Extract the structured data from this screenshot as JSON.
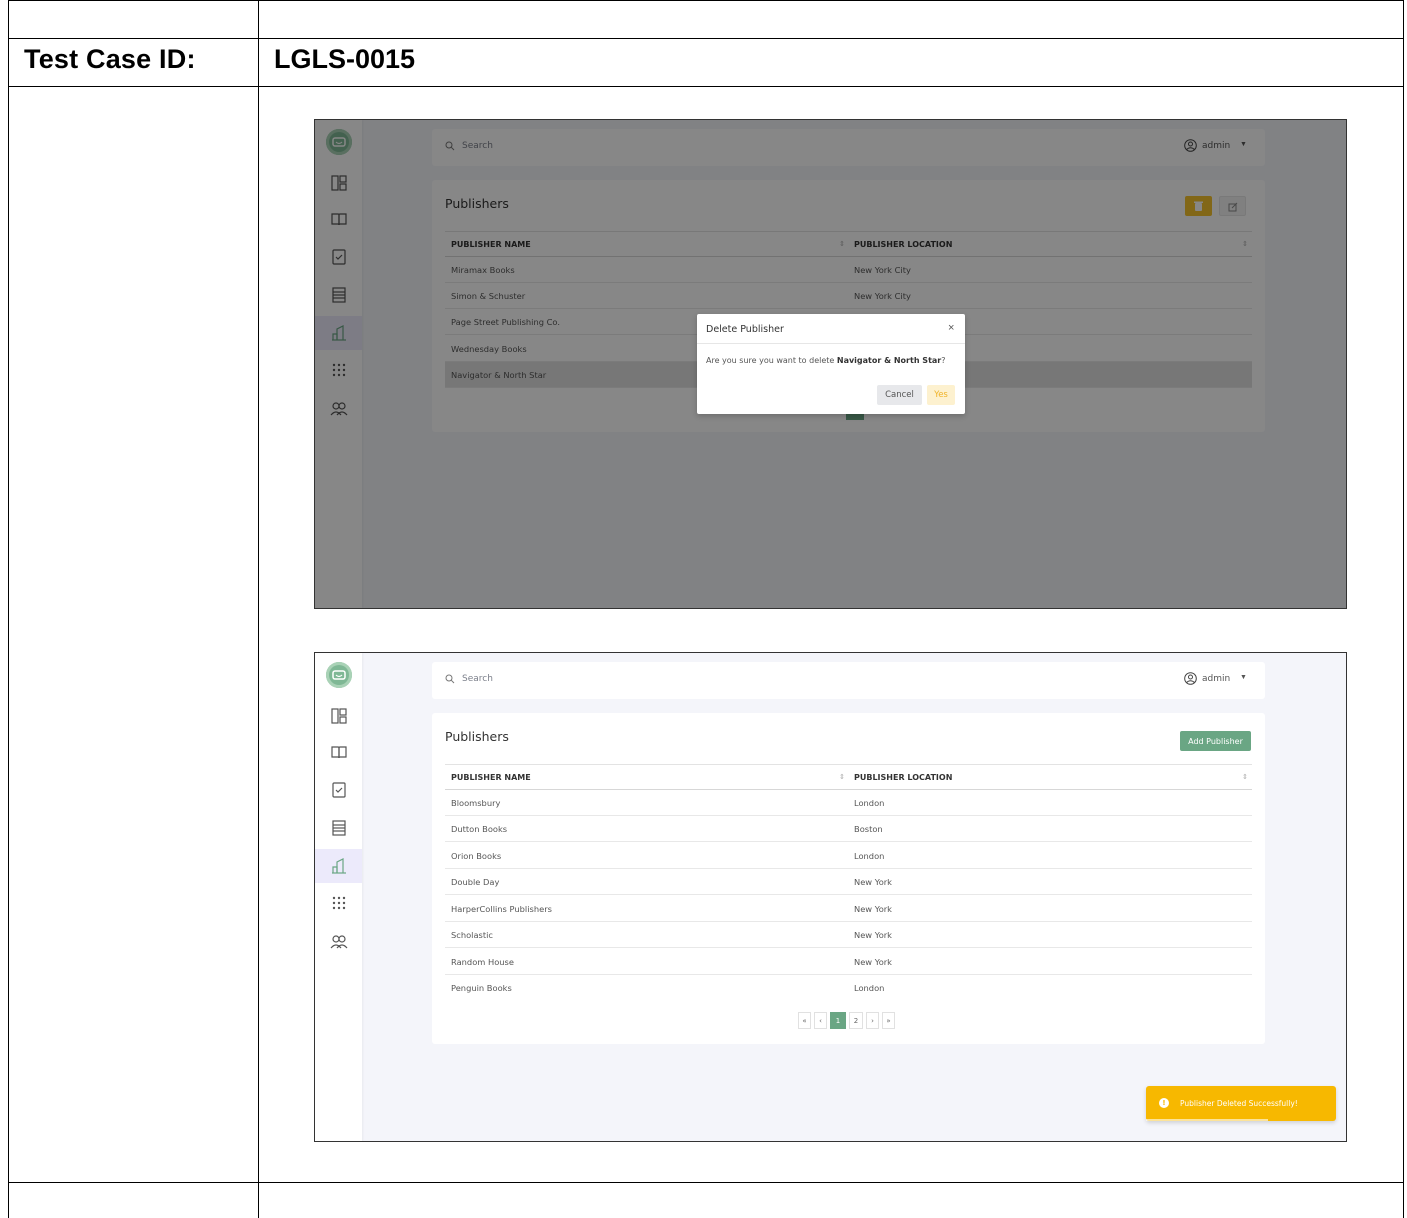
{
  "document": {
    "test_case_label": "Test Case ID:",
    "test_case_value": "LGLS-0015"
  },
  "screen1": {
    "search_placeholder": "Search",
    "user_name": "admin",
    "panel_title": "Publishers",
    "columns": [
      "PUBLISHER NAME",
      "PUBLISHER LOCATION"
    ],
    "rows": [
      {
        "name": "Miramax Books",
        "location": "New York City"
      },
      {
        "name": "Simon & Schuster",
        "location": "New York City"
      },
      {
        "name": "Page Street Publishing Co.",
        "location": ""
      },
      {
        "name": "Wednesday Books",
        "location": ""
      },
      {
        "name": "Navigator & North Star",
        "location": ""
      }
    ],
    "modal": {
      "title": "Delete Publisher",
      "close": "×",
      "message_prefix": "Are you sure you want to delete ",
      "message_bold": "Navigator & North Star",
      "message_suffix": "?",
      "cancel_label": "Cancel",
      "yes_label": "Yes"
    }
  },
  "screen2": {
    "search_placeholder": "Search",
    "user_name": "admin",
    "panel_title": "Publishers",
    "add_button_label": "Add Publisher",
    "columns": [
      "PUBLISHER NAME",
      "PUBLISHER LOCATION"
    ],
    "rows": [
      {
        "name": "Bloomsbury",
        "location": "London"
      },
      {
        "name": "Dutton Books",
        "location": "Boston"
      },
      {
        "name": "Orion Books",
        "location": "London"
      },
      {
        "name": "Double Day",
        "location": "New York"
      },
      {
        "name": "HarperCollins Publishers",
        "location": "New York"
      },
      {
        "name": "Scholastic",
        "location": "New York"
      },
      {
        "name": "Random House",
        "location": "New York"
      },
      {
        "name": "Penguin Books",
        "location": "London"
      }
    ],
    "pagination": {
      "first": "«",
      "prev": "‹",
      "pages": [
        "1",
        "2"
      ],
      "current": "1",
      "next": "›",
      "last": "»"
    },
    "toast": {
      "icon": "!",
      "text": "Publisher Deleted Successfully!"
    }
  },
  "colors": {
    "accent": "#6aa684",
    "warning": "#f7b800",
    "background": "#f4f5fa"
  },
  "icons": [
    "logo-icon",
    "dashboard-icon",
    "book-icon",
    "bookmark-icon",
    "list-icon",
    "publisher-building-icon",
    "grid-icon",
    "users-icon",
    "search-icon",
    "user-circle-icon",
    "trash-icon",
    "edit-icon"
  ]
}
